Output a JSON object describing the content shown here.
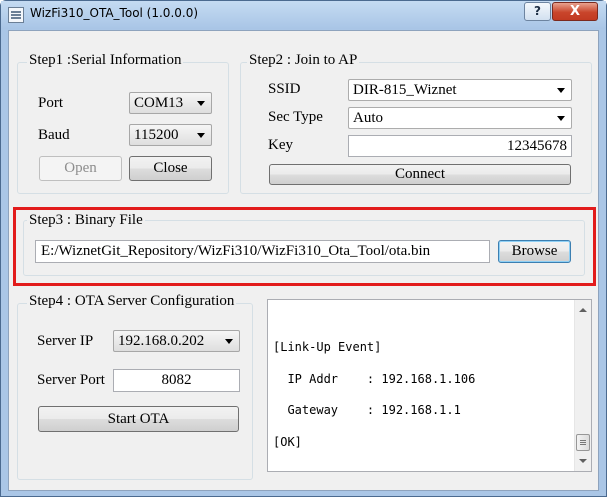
{
  "window": {
    "title": "WizFi310_OTA_Tool (1.0.0.0)",
    "help_label": "?",
    "close_label": "X"
  },
  "step1": {
    "title": "Step1 :Serial Information",
    "port_label": "Port",
    "port_value": "COM13",
    "baud_label": "Baud",
    "baud_value": "115200",
    "open_label": "Open",
    "close_label": "Close"
  },
  "step2": {
    "title": "Step2 : Join to AP",
    "ssid_label": "SSID",
    "ssid_value": "DIR-815_Wiznet",
    "sectype_label": "Sec Type",
    "sectype_value": "Auto",
    "key_label": "Key",
    "key_value": "12345678",
    "connect_label": "Connect"
  },
  "step3": {
    "title": "Step3 : Binary File",
    "path_value": "E:/WiznetGit_Repository/WizFi310/WizFi310_Ota_Tool/ota.bin",
    "browse_label": "Browse",
    "highlight_color": "#e21b1b"
  },
  "step4": {
    "title": "Step4 : OTA Server Configuration",
    "server_ip_label": "Server IP",
    "server_ip_value": "192.168.0.202",
    "server_port_label": "Server Port",
    "server_port_value": "8082",
    "start_label": "Start OTA"
  },
  "log": {
    "lines": [
      "[Link-Up Event]",
      "  IP Addr    : 192.168.1.106",
      "  Gateway    : 192.168.1.1",
      "[OK]"
    ]
  }
}
